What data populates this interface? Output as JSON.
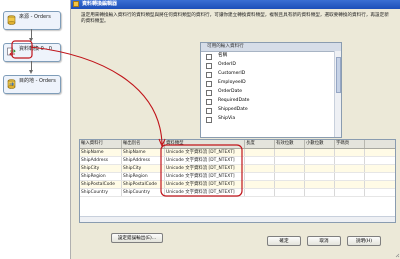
{
  "flow": {
    "nodes": [
      {
        "label": "來源 - Orders",
        "icon": "database-source-icon"
      },
      {
        "label": "資料轉換 0 - 0",
        "icon": "data-conversion-icon"
      },
      {
        "label": "目的地 - Orders",
        "icon": "database-destination-icon"
      }
    ]
  },
  "dialog": {
    "title": "資料轉換編輯器",
    "description": "設定用來轉換輸入資料行的資料類型與將任何資料類型的資料行，可讓你建立轉換資料類型，複製且具有新的資料類型，選取要轉換的資料行，再設定新的資料類型。",
    "input_columns": {
      "header": "可用的輸入資料行",
      "items": [
        {
          "label": "名稱",
          "checked": false
        },
        {
          "label": "OrderID",
          "checked": false
        },
        {
          "label": "CustomerID",
          "checked": false
        },
        {
          "label": "EmployeeID",
          "checked": false
        },
        {
          "label": "OrderDate",
          "checked": false
        },
        {
          "label": "RequiredDate",
          "checked": false
        },
        {
          "label": "ShippedDate",
          "checked": false
        },
        {
          "label": "ShipVia",
          "checked": false
        }
      ]
    },
    "grid": {
      "headers": [
        "輸入資料行",
        "輸出別名",
        "資料類型",
        "長度",
        "有效位數",
        "小數位數",
        "字碼頁"
      ],
      "rows": [
        [
          "ShipName",
          "ShipName",
          "Unicode 文字資料流 [DT_NTEXT]",
          "",
          "",
          "",
          ""
        ],
        [
          "ShipAddress",
          "ShipAddress",
          "Unicode 文字資料流 [DT_NTEXT]",
          "",
          "",
          "",
          ""
        ],
        [
          "ShipCity",
          "ShipCity",
          "Unicode 文字資料流 [DT_NTEXT]",
          "",
          "",
          "",
          ""
        ],
        [
          "ShipRegion",
          "ShipRegion",
          "Unicode 文字資料流 [DT_NTEXT]",
          "",
          "",
          "",
          ""
        ],
        [
          "ShipPostalCode",
          "ShipPostalCode",
          "Unicode 文字資料流 [DT_NTEXT]",
          "",
          "",
          "",
          ""
        ],
        [
          "ShipCountry",
          "ShipCountry",
          "Unicode 文字資料流 [DT_NTEXT]",
          "",
          "",
          "",
          ""
        ]
      ]
    },
    "buttons": {
      "error_output": "設定錯誤輸出(E)...",
      "ok": "確定",
      "cancel": "取消",
      "help": "說明(H)"
    },
    "colors": {
      "highlight": "#c0141a",
      "titlebar": "#1c4fb8"
    }
  }
}
